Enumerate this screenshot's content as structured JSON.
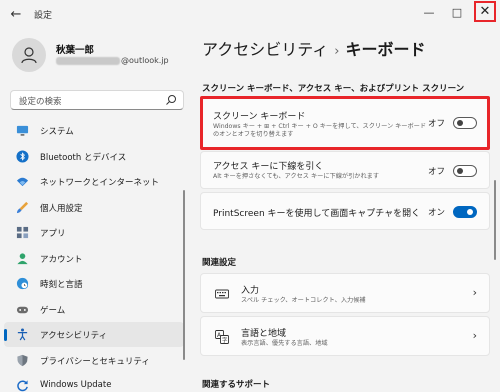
{
  "window": {
    "title": "設定",
    "back_glyph": "←",
    "min_glyph": "—",
    "max_glyph": "□",
    "close_glyph": "✕"
  },
  "user": {
    "name": "秋葉一郎",
    "email_suffix": "@outlook.jp"
  },
  "search": {
    "placeholder": "設定の検索"
  },
  "nav": {
    "items": [
      {
        "label": "システム",
        "icon": "monitor-icon"
      },
      {
        "label": "Bluetooth とデバイス",
        "icon": "bluetooth-icon"
      },
      {
        "label": "ネットワークとインターネット",
        "icon": "wifi-icon"
      },
      {
        "label": "個人用設定",
        "icon": "brush-icon"
      },
      {
        "label": "アプリ",
        "icon": "apps-icon"
      },
      {
        "label": "アカウント",
        "icon": "account-icon"
      },
      {
        "label": "時刻と言語",
        "icon": "globe-clock-icon"
      },
      {
        "label": "ゲーム",
        "icon": "game-icon"
      },
      {
        "label": "アクセシビリティ",
        "icon": "accessibility-icon",
        "active": true
      },
      {
        "label": "プライバシーとセキュリティ",
        "icon": "shield-icon"
      },
      {
        "label": "Windows Update",
        "icon": "update-icon"
      }
    ]
  },
  "main": {
    "breadcrumb_parent": "アクセシビリティ",
    "breadcrumb_sep": "›",
    "breadcrumb_current": "キーボード",
    "section1": "スクリーン キーボード、アクセス キー、およびプリント スクリーン",
    "osk": {
      "title": "スクリーン キーボード",
      "desc_line1": "Windows キー + ⊞ + Ctrl キー + O キーを押して、スクリーン キーボード",
      "desc_line2": "のオンとオフを切り替えます",
      "state_label": "オフ"
    },
    "underline": {
      "title": "アクセス キーに下線を引く",
      "desc": "Alt キーを押さなくても、アクセス キーに下線が引かれます",
      "state_label": "オフ"
    },
    "printscreen": {
      "title": "PrintScreen キーを使用して画面キャプチャを開く",
      "state_label": "オン"
    },
    "section2": "関連設定",
    "input": {
      "title": "入力",
      "desc": "スペル チェック、オートコレクト、入力候補"
    },
    "language": {
      "title": "言語と地域",
      "desc": "表示言語、優先する言語、地域"
    },
    "section3": "関連するサポート",
    "chevron": "›"
  },
  "colors": {
    "accent": "#0067c0",
    "highlight": "#e8252a"
  }
}
